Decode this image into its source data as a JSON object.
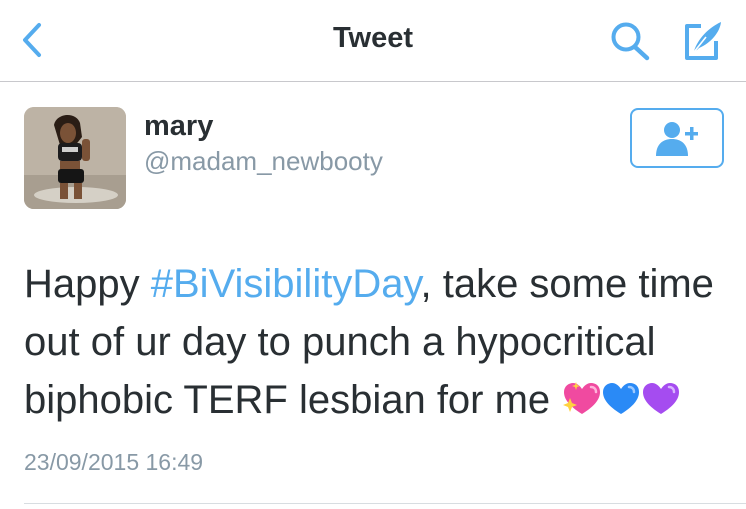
{
  "nav": {
    "title": "Tweet",
    "back_icon": "chevron-left-icon",
    "search_icon": "search-icon",
    "compose_icon": "compose-icon"
  },
  "tweet": {
    "author_name": "mary",
    "author_handle": "@madam_newbooty",
    "text_before": "Happy ",
    "hashtag": "#BiVisibilityDay",
    "text_after": ", take some time out of ur day to punch a hypocritical biphobic TERF lesbian for me ",
    "emojis": [
      "sparkling-heart-emoji",
      "blue-heart-emoji",
      "purple-heart-emoji"
    ],
    "timestamp": "23/09/2015 16:49",
    "follow_icon": "add-user-icon"
  },
  "colors": {
    "accent": "#55acee",
    "text": "#292f33",
    "secondary_text": "#8899a6"
  }
}
